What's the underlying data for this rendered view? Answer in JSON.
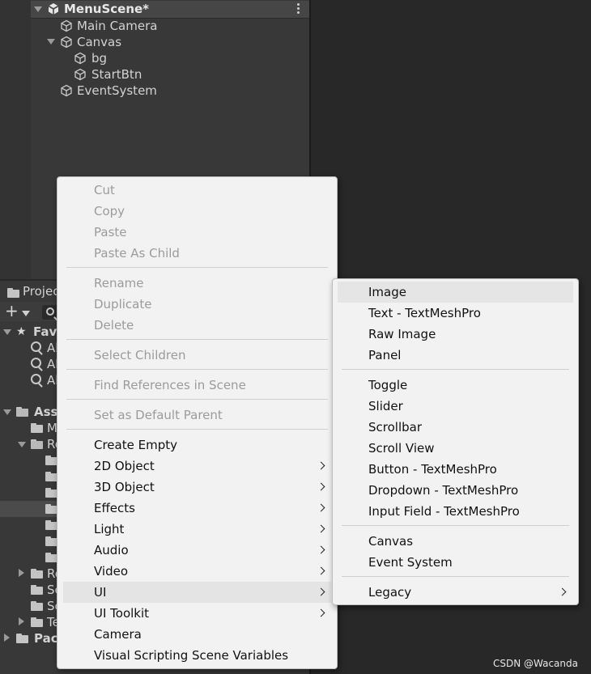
{
  "hierarchy": {
    "scene_name": "MenuScene*",
    "items": [
      {
        "label": "Main Camera"
      },
      {
        "label": "Canvas"
      },
      {
        "label": "bg"
      },
      {
        "label": "StartBtn"
      },
      {
        "label": "EventSystem"
      }
    ]
  },
  "project": {
    "tab_label": "Project",
    "sections": {
      "favorites": "Favorites",
      "assets": "Assets",
      "packages": "Packages"
    },
    "favorite_items": [
      "All",
      "All",
      "All"
    ],
    "asset_items": [
      "M",
      "Re",
      "Re",
      "Sc",
      "Sc",
      "Te"
    ]
  },
  "context_menu": {
    "items": [
      {
        "label": "Cut",
        "enabled": false
      },
      {
        "label": "Copy",
        "enabled": false
      },
      {
        "label": "Paste",
        "enabled": false
      },
      {
        "label": "Paste As Child",
        "enabled": false
      },
      {
        "label": "Rename",
        "enabled": false
      },
      {
        "label": "Duplicate",
        "enabled": false
      },
      {
        "label": "Delete",
        "enabled": false
      },
      {
        "label": "Select Children",
        "enabled": false
      },
      {
        "label": "Find References in Scene",
        "enabled": false
      },
      {
        "label": "Set as Default Parent",
        "enabled": false
      },
      {
        "label": "Create Empty",
        "enabled": true
      },
      {
        "label": "2D Object",
        "enabled": true,
        "submenu": true
      },
      {
        "label": "3D Object",
        "enabled": true,
        "submenu": true
      },
      {
        "label": "Effects",
        "enabled": true,
        "submenu": true
      },
      {
        "label": "Light",
        "enabled": true,
        "submenu": true
      },
      {
        "label": "Audio",
        "enabled": true,
        "submenu": true
      },
      {
        "label": "Video",
        "enabled": true,
        "submenu": true
      },
      {
        "label": "UI",
        "enabled": true,
        "submenu": true,
        "highlighted": true
      },
      {
        "label": "UI Toolkit",
        "enabled": true,
        "submenu": true
      },
      {
        "label": "Camera",
        "enabled": true
      },
      {
        "label": "Visual Scripting Scene Variables",
        "enabled": true
      }
    ]
  },
  "ui_submenu": {
    "items": [
      {
        "label": "Image",
        "highlighted": true
      },
      {
        "label": "Text - TextMeshPro"
      },
      {
        "label": "Raw Image"
      },
      {
        "label": "Panel"
      },
      {
        "label": "Toggle"
      },
      {
        "label": "Slider"
      },
      {
        "label": "Scrollbar"
      },
      {
        "label": "Scroll View"
      },
      {
        "label": "Button - TextMeshPro"
      },
      {
        "label": "Dropdown - TextMeshPro"
      },
      {
        "label": "Input Field - TextMeshPro"
      },
      {
        "label": "Canvas"
      },
      {
        "label": "Event System"
      },
      {
        "label": "Legacy",
        "submenu": true
      }
    ]
  },
  "watermark": "CSDN @Wacanda"
}
